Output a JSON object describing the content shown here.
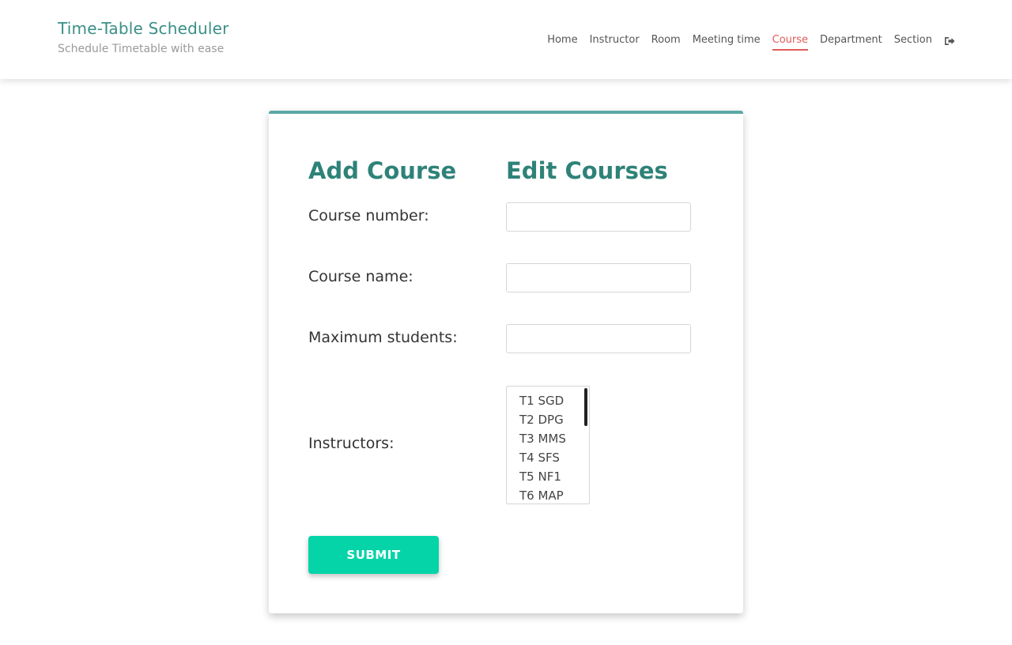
{
  "brand": {
    "title": "Time-Table Scheduler",
    "subtitle": "Schedule Timetable with ease"
  },
  "nav": {
    "items": [
      {
        "label": "Home"
      },
      {
        "label": "Instructor"
      },
      {
        "label": "Room"
      },
      {
        "label": "Meeting time"
      },
      {
        "label": "Course"
      },
      {
        "label": "Department"
      },
      {
        "label": "Section"
      }
    ],
    "active": "Course",
    "logout_icon": "sign-out-icon"
  },
  "form": {
    "add_heading": "Add Course",
    "edit_heading": "Edit Courses",
    "course_number_label": "Course number:",
    "course_number_value": "",
    "course_name_label": "Course name:",
    "course_name_value": "",
    "max_students_label": "Maximum students:",
    "max_students_value": "",
    "instructors_label": "Instructors:",
    "instructors": [
      "T1 SGD",
      "T2 DPG",
      "T3 MMS",
      "T4 SFS",
      "T5 NF1",
      "T6 MAP"
    ],
    "submit_label": "SUBMIT"
  },
  "colors": {
    "accent_teal": "#2e8278",
    "card_border": "#5aa9a4",
    "active_nav": "#e05a5a",
    "submit_bg": "#05d4a8"
  }
}
